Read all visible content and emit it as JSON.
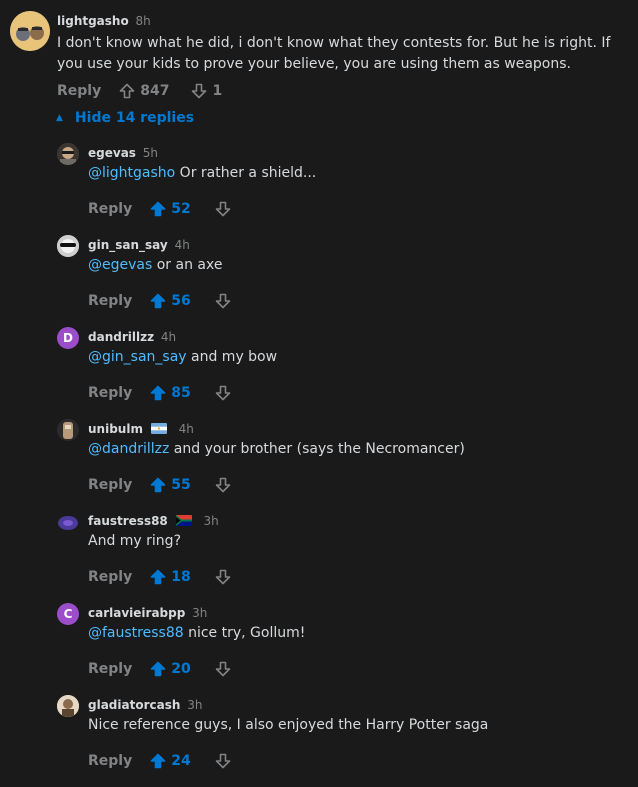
{
  "root": {
    "username": "lightgasho",
    "time": "8h",
    "body": "I don't know what he did, i don't know what they contests for. But he is right. If you use your kids to prove your believe, you are using them as weapons.",
    "reply_label": "Reply",
    "upvotes": "847",
    "downvotes": "1",
    "avatar_icon": "avatar-icon"
  },
  "hide_replies_label": "Hide 14 replies",
  "colors": {
    "accent": "#0079d3",
    "mention": "#4fbcff",
    "background": "#1a1a1b"
  },
  "replies": [
    {
      "username": "egevas",
      "time": "5h",
      "mention": "@lightgasho",
      "text": " Or rather a shield...",
      "reply_label": "Reply",
      "upvotes": "52"
    },
    {
      "username": "gin_san_say",
      "time": "4h",
      "mention": "@egevas",
      "text": " or an axe",
      "reply_label": "Reply",
      "upvotes": "56"
    },
    {
      "username": "dandrillzz",
      "time": "4h",
      "mention": "@gin_san_say",
      "text": " and my bow",
      "reply_label": "Reply",
      "upvotes": "85",
      "avatar_letter": "D"
    },
    {
      "username": "unibulm",
      "time": "4h",
      "mention": "@dandrillzz",
      "text": " and your brother (says the Necromancer)",
      "reply_label": "Reply",
      "upvotes": "55"
    },
    {
      "username": "faustress88",
      "time": "3h",
      "mention": "",
      "text": "And my ring?",
      "reply_label": "Reply",
      "upvotes": "18"
    },
    {
      "username": "carlavieirabpp",
      "time": "3h",
      "mention": "@faustress88",
      "text": " nice try, Gollum!",
      "reply_label": "Reply",
      "upvotes": "20",
      "avatar_letter": "C"
    },
    {
      "username": "gladiatorcash",
      "time": "3h",
      "mention": "",
      "text": "Nice reference guys, I also enjoyed the Harry Potter saga",
      "reply_label": "Reply",
      "upvotes": "24"
    }
  ]
}
